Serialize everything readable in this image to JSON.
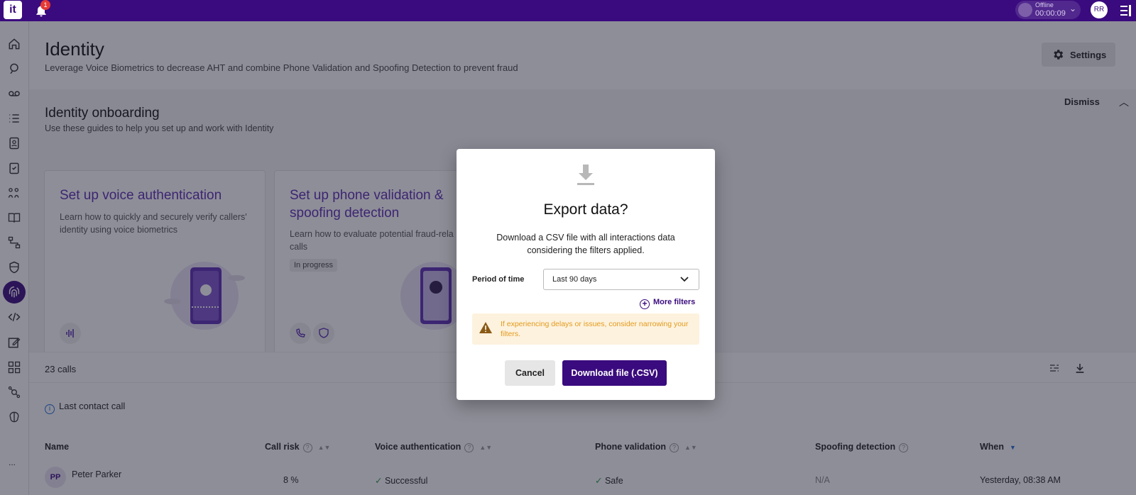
{
  "topbar": {
    "logo": "it",
    "notification_count": "1",
    "status_label": "Offline",
    "status_time": "00:00:09",
    "user_initials": "RR"
  },
  "sidebar": {
    "icons": [
      "home-icon",
      "chat-icon",
      "voicemail-icon",
      "list-icon",
      "contacts-icon",
      "clipboard-icon",
      "workflow-icon",
      "book-icon",
      "flow-icon",
      "shield-icon",
      "fingerprint-icon",
      "code-icon",
      "edit-icon",
      "apps-icon",
      "integrations-icon",
      "brain-icon"
    ],
    "more": "..."
  },
  "page": {
    "title": "Identity",
    "subtitle": "Leverage Voice Biometrics to decrease AHT and combine Phone Validation and Spoofing Detection to prevent fraud",
    "settings_label": "Settings"
  },
  "onboarding": {
    "title": "Identity onboarding",
    "subtitle": "Use these guides to help you set up and work with Identity",
    "dismiss_label": "Dismiss",
    "cards": [
      {
        "title": "Set up voice authentication",
        "description": "Learn how to quickly and securely verify callers' identity using voice biometrics"
      },
      {
        "title": "Set up phone validation & spoofing detection",
        "description": "Learn how to evaluate potential fraud-rela calls",
        "badge": "In progress"
      }
    ]
  },
  "calls": {
    "count_label": "23 calls",
    "last_contact_label": "Last contact call",
    "columns": [
      "Name",
      "Call risk",
      "Voice authentication",
      "Phone validation",
      "Spoofing detection",
      "When"
    ],
    "rows": [
      {
        "initials": "PP",
        "name": "Peter Parker",
        "call_risk": "8 %",
        "voice_authentication": "Successful",
        "phone_validation": "Safe",
        "spoofing_detection": "N/A",
        "when": "Yesterday, 08:38 AM"
      }
    ]
  },
  "modal": {
    "title": "Export data?",
    "description": "Download a CSV file with all interactions data considering the filters applied.",
    "period_label": "Period of time",
    "period_value": "Last 90 days",
    "more_filters_label": "More filters",
    "warning": "If experiencing delays or issues, consider narrowing your filters.",
    "cancel_label": "Cancel",
    "download_label": "Download file (.CSV)"
  },
  "colors": {
    "brand": "#3a0b7e",
    "accent_text": "#5b2db3",
    "warning_text": "#e39a1b",
    "warning_bg": "#fdf2de"
  }
}
